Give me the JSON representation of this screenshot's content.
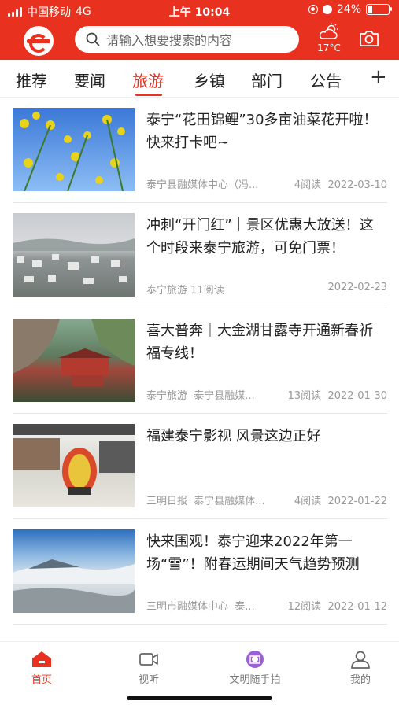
{
  "status": {
    "carrier": "中国移动",
    "network": "4G",
    "time": "上午 10:04",
    "battery": "24%",
    "battery_level": 0.24
  },
  "header": {
    "search_placeholder": "请输入想要搜索的内容",
    "temperature": "17°C"
  },
  "tabs": [
    "推荐",
    "要闻",
    "旅游",
    "乡镇",
    "部门",
    "公告"
  ],
  "active_tab": "旅游",
  "articles": [
    {
      "title": "泰宁“花田锦鲤”30多亩油菜花开啦！快来打卡吧~",
      "source": "泰宁县融媒体中心（冯...",
      "reads": "4阅读",
      "date": "2022-03-10"
    },
    {
      "title": "冲刺“开门红”｜景区优惠大放送！这个时段来泰宁旅游，可免门票！",
      "source": "泰宁旅游",
      "reads": "11阅读",
      "date": "2022-02-23"
    },
    {
      "title": "喜大普奔｜大金湖甘露寺开通新春祈福专线！",
      "source": "泰宁旅游",
      "source2": "泰宁县融媒...",
      "reads": "13阅读",
      "date": "2022-01-30"
    },
    {
      "title": "福建泰宁影视 风景这边正好",
      "source": "三明日报",
      "source2": "泰宁县融媒体...",
      "reads": "4阅读",
      "date": "2022-01-22"
    },
    {
      "title": "快来围观！泰宁迎来2022年第一场“雪”！附春运期间天气趋势预测",
      "source": "三明市融媒体中心",
      "source2": "泰...",
      "reads": "12阅读",
      "date": "2022-01-12"
    }
  ],
  "tabbar": [
    "首页",
    "视听",
    "文明随手拍",
    "我的"
  ]
}
